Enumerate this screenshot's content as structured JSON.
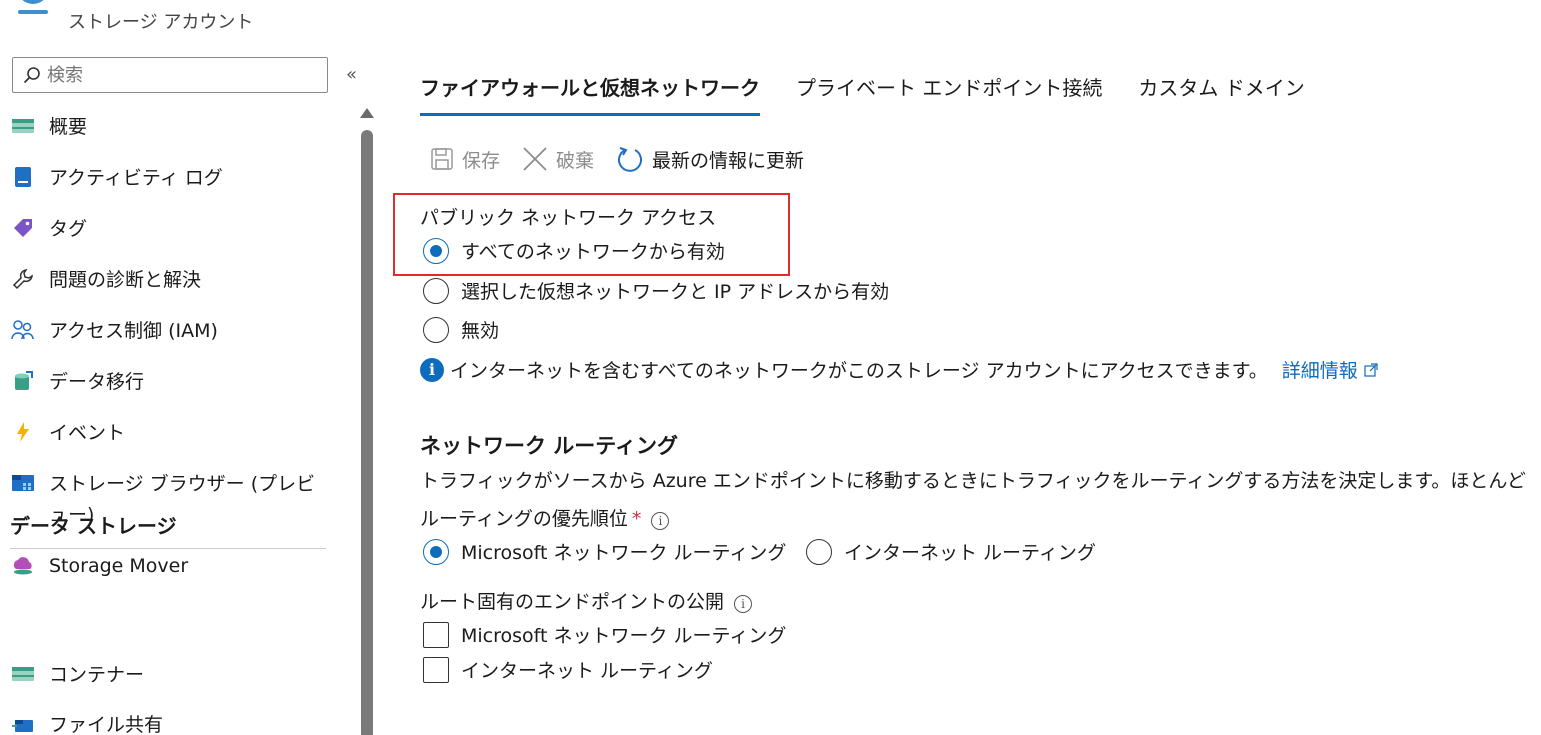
{
  "header": {
    "subtitle": "ストレージ アカウント"
  },
  "search": {
    "placeholder": "検索",
    "collapse": "«"
  },
  "sidebar": {
    "items": [
      {
        "label": "概要",
        "icon": "overview-icon"
      },
      {
        "label": "アクティビティ ログ",
        "icon": "activity-log-icon"
      },
      {
        "label": "タグ",
        "icon": "tag-icon"
      },
      {
        "label": "問題の診断と解決",
        "icon": "wrench-icon"
      },
      {
        "label": "アクセス制御 (IAM)",
        "icon": "people-icon"
      },
      {
        "label": "データ移行",
        "icon": "data-migration-icon"
      },
      {
        "label": "イベント",
        "icon": "lightning-icon"
      },
      {
        "label": "ストレージ ブラウザー (プレビュー)",
        "icon": "storage-browser-icon"
      },
      {
        "label": "Storage Mover",
        "icon": "cloud-icon"
      }
    ],
    "section_title": "データ ストレージ",
    "section_items": [
      {
        "label": "コンテナー",
        "icon": "container-icon"
      },
      {
        "label": "ファイル共有",
        "icon": "file-share-icon"
      }
    ]
  },
  "tabs": [
    {
      "label": "ファイアウォールと仮想ネットワーク",
      "active": true
    },
    {
      "label": "プライベート エンドポイント接続",
      "active": false
    },
    {
      "label": "カスタム ドメイン",
      "active": false
    }
  ],
  "toolbar": {
    "save": "保存",
    "discard": "破棄",
    "refresh": "最新の情報に更新"
  },
  "public_access": {
    "label": "パブリック ネットワーク アクセス",
    "options": [
      {
        "label": "すべてのネットワークから有効",
        "selected": true
      },
      {
        "label": "選択した仮想ネットワークと IP アドレスから有効",
        "selected": false
      },
      {
        "label": "無効",
        "selected": false
      }
    ],
    "info_text": "インターネットを含むすべてのネットワークがこのストレージ アカウントにアクセスできます。",
    "info_link": "詳細情報"
  },
  "routing": {
    "title": "ネットワーク ルーティング",
    "description": "トラフィックがソースから Azure エンドポイントに移動するときにトラフィックをルーティングする方法を決定します。ほとんど",
    "preference_label": "ルーティングの優先順位",
    "required_mark": "*",
    "preference_options": [
      {
        "label": "Microsoft ネットワーク ルーティング",
        "selected": true
      },
      {
        "label": "インターネット ルーティング",
        "selected": false
      }
    ],
    "publish_label": "ルート固有のエンドポイントの公開",
    "publish_options": [
      {
        "label": "Microsoft ネットワーク ルーティング",
        "checked": false
      },
      {
        "label": "インターネット ルーティング",
        "checked": false
      }
    ]
  },
  "colors": {
    "accent": "#0f6cbd",
    "highlight": "#e02b2b"
  }
}
